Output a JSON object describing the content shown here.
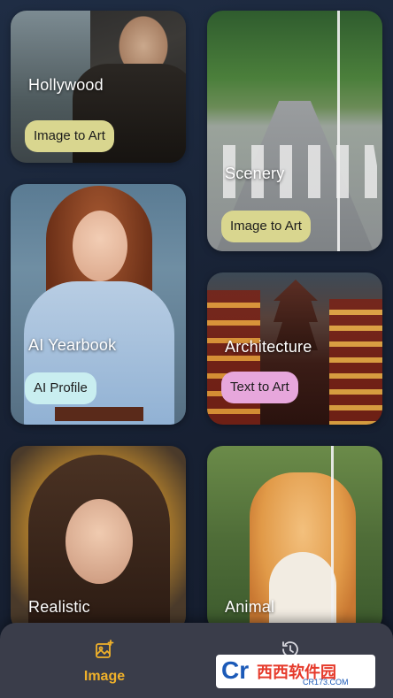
{
  "cards": [
    {
      "title": "Hollywood",
      "pill": "Image to Art"
    },
    {
      "title": "Scenery",
      "pill": "Image to Art"
    },
    {
      "title": "AI Yearbook",
      "pill": "AI Profile"
    },
    {
      "title": "Architecture",
      "pill": "Text to Art"
    },
    {
      "title": "Realistic"
    },
    {
      "title": "Animal"
    }
  ],
  "bottom_nav": {
    "items": [
      {
        "label": "Image",
        "icon": "magic-image-icon",
        "active": true
      },
      {
        "icon": "history-icon"
      }
    ],
    "active_color": "#f0b12a"
  },
  "watermark": {
    "logo_letters": "Cr",
    "brand": "西西软件园",
    "site": "CR173.COM"
  },
  "colors": {
    "pill_image_to_art": "#d9d68f",
    "pill_ai_profile": "#c9eef0",
    "pill_text_to_art": "#e7a7dc",
    "background": "#182235"
  }
}
